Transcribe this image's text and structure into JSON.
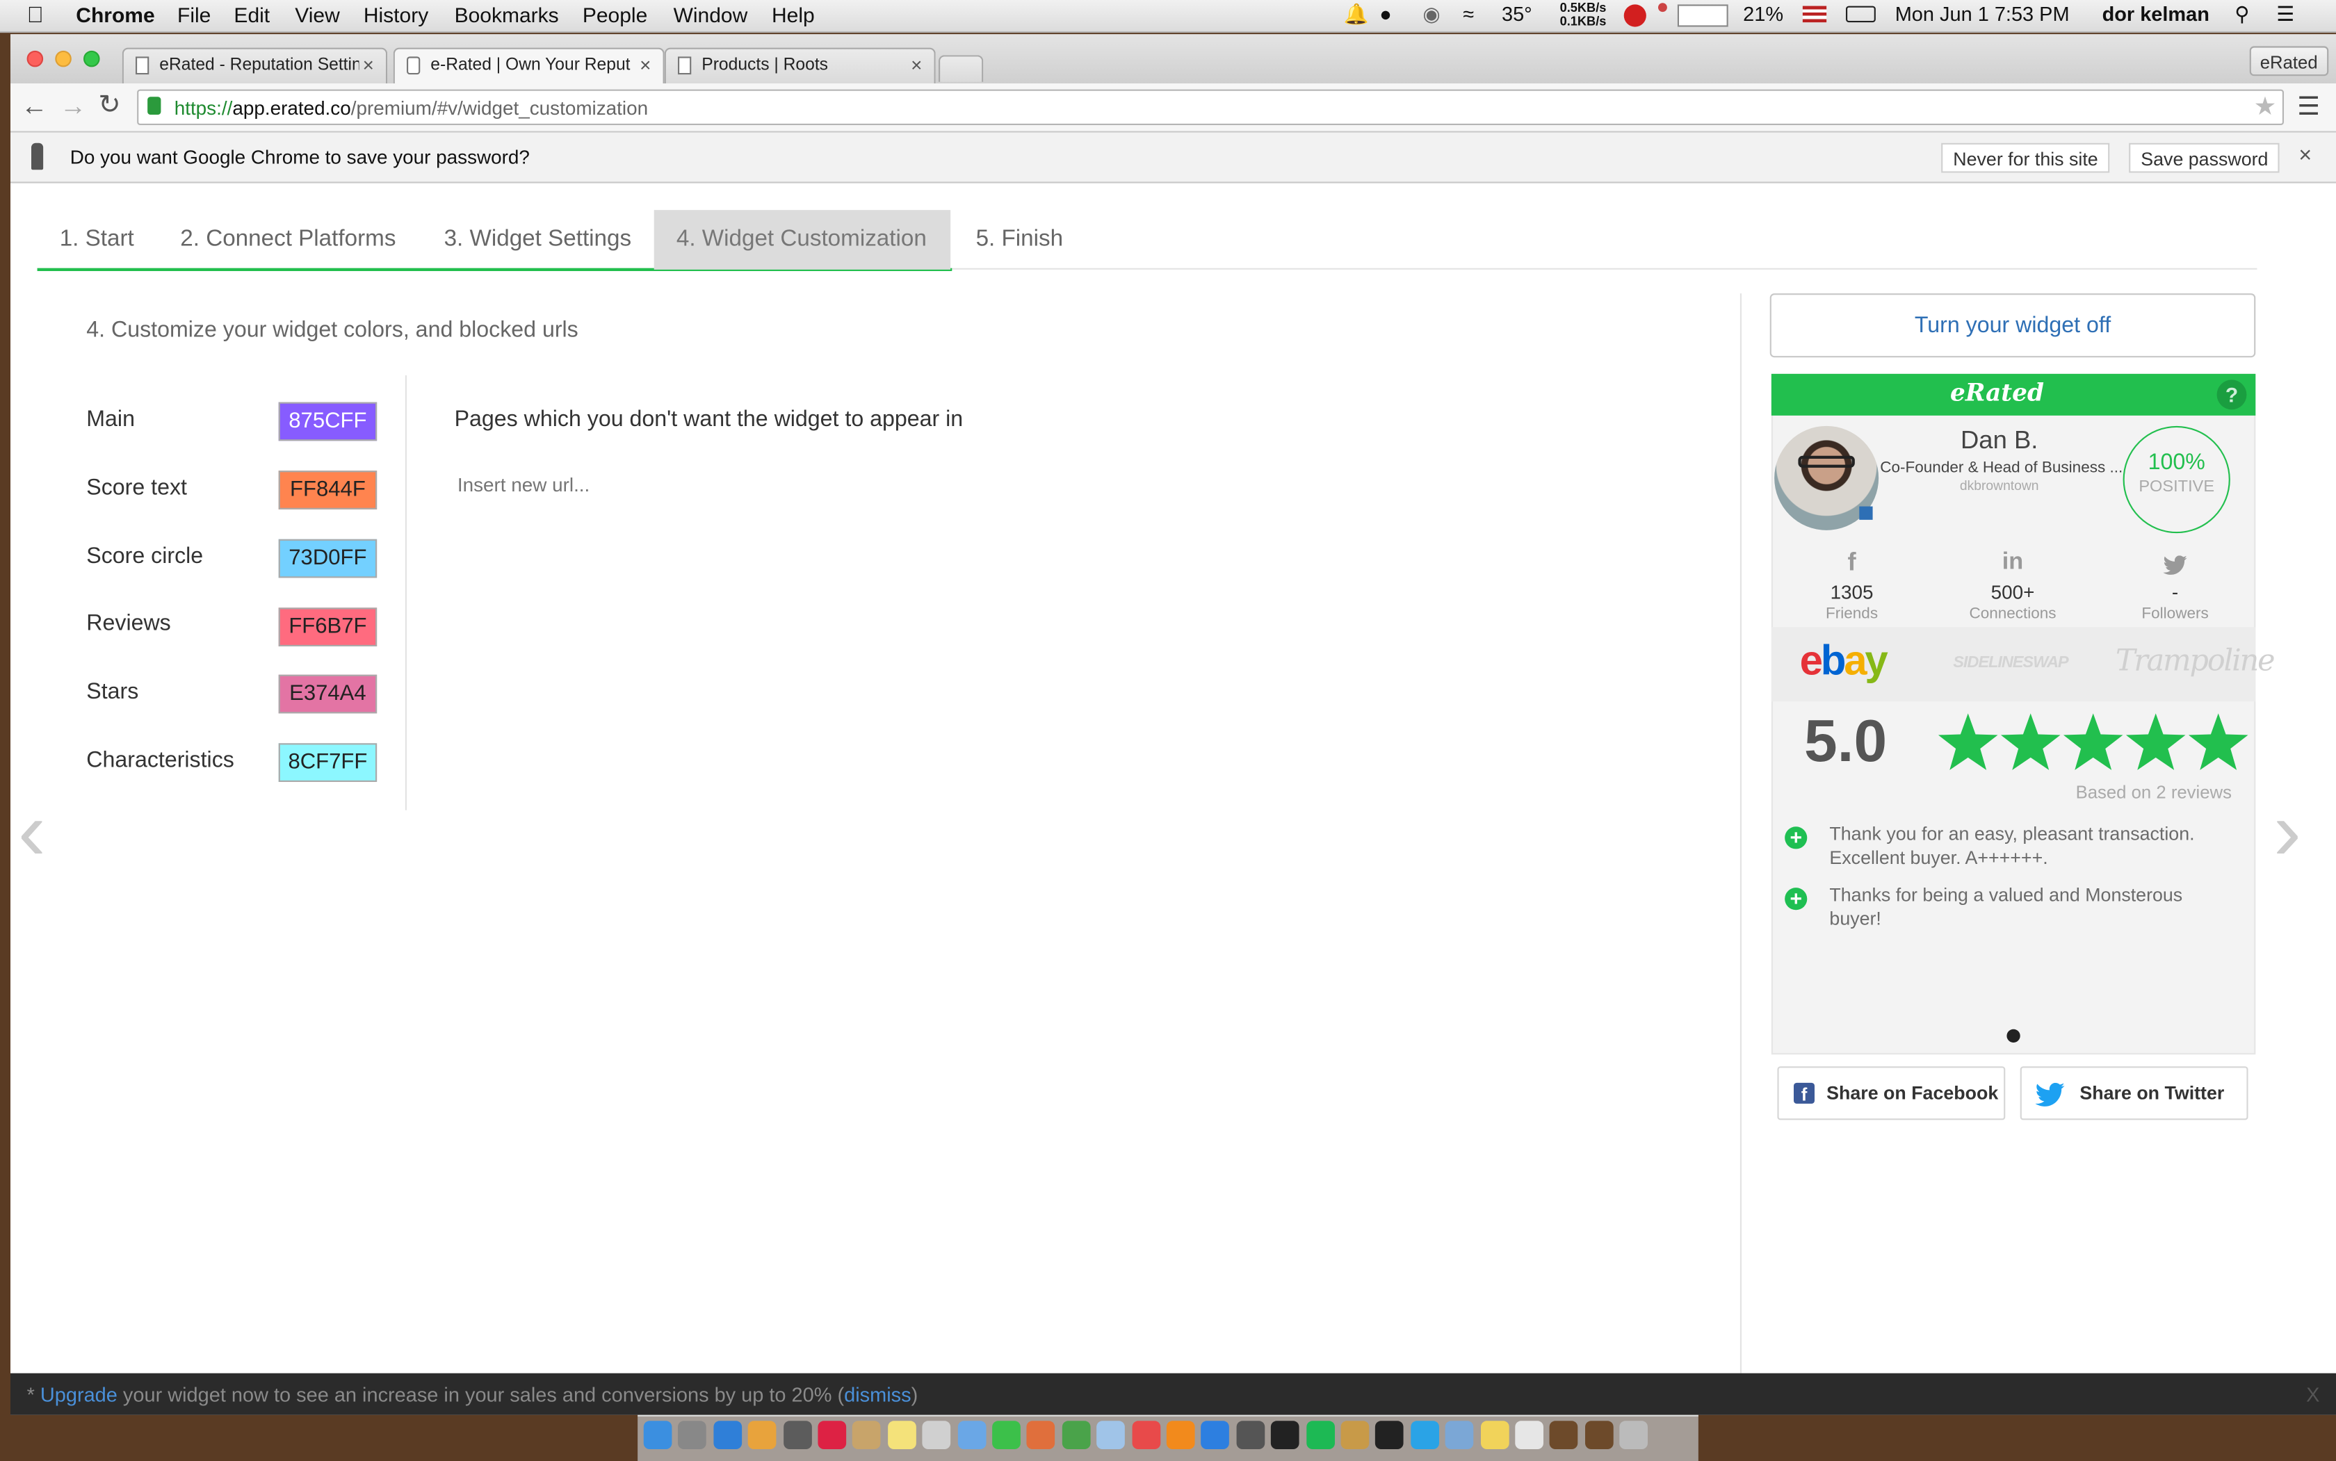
{
  "menubar": {
    "app": "Chrome",
    "items": [
      "File",
      "Edit",
      "View",
      "History",
      "Bookmarks",
      "People",
      "Window",
      "Help"
    ],
    "temperature": "35°",
    "net_up": "0.5KB/s",
    "net_down": "0.1KB/s",
    "battery": "21%",
    "datetime": "Mon Jun 1  7:53 PM",
    "user": "dor kelman"
  },
  "browser": {
    "tabs": [
      {
        "title": "eRated - Reputation Settin"
      },
      {
        "title": "e-Rated | Own Your Reputa"
      },
      {
        "title": "Products | Roots"
      }
    ],
    "profile": "eRated",
    "url_scheme": "https://",
    "url_host": "app.erated.co",
    "url_path": "/premium/#v/widget_customization",
    "infobar": {
      "message": "Do you want Google Chrome to save your password?",
      "never_label": "Never for this site",
      "save_label": "Save password"
    }
  },
  "wizard": {
    "tabs": [
      "1. Start",
      "2. Connect Platforms",
      "3. Widget Settings",
      "4. Widget Customization",
      "5. Finish"
    ],
    "active_tab": 3,
    "heading": "4. Customize your widget colors, and blocked urls",
    "colors": [
      {
        "label": "Main",
        "value": "875CFF",
        "color": "#875CFF"
      },
      {
        "label": "Score text",
        "value": "FF844F",
        "color": "#FF844F"
      },
      {
        "label": "Score circle",
        "value": "73D0FF",
        "color": "#73D0FF"
      },
      {
        "label": "Reviews",
        "value": "FF6B7F",
        "color": "#FF6B7F"
      },
      {
        "label": "Stars",
        "value": "E374A4",
        "color": "#E374A4"
      },
      {
        "label": "Characteristics",
        "value": "8CF7FF",
        "color": "#8CF7FF"
      }
    ],
    "blocked_urls_title": "Pages which you don't want the widget to appear in",
    "url_placeholder": "Insert new url..."
  },
  "widget": {
    "turn_off_label": "Turn your widget off",
    "brand": "eRated",
    "help": "?",
    "profile": {
      "name": "Dan B.",
      "title": "Co-Founder & Head of Business ...",
      "username": "dkbrowntown",
      "score": "100%",
      "score_label": "POSITIVE"
    },
    "social": [
      {
        "icon": "f",
        "count": "1305",
        "label": "Friends"
      },
      {
        "icon": "in",
        "count": "500+",
        "label": "Connections"
      },
      {
        "icon": "twitter-bird",
        "count": "-",
        "label": "Followers"
      }
    ],
    "platforms": [
      "ebay",
      "SIDELINESWAP",
      "Trampoline"
    ],
    "rating": "5.0",
    "stars": 5,
    "based_on": "Based on 2 reviews",
    "reviews": [
      "Thank you for an easy, pleasant transaction. Excellent buyer. A++++++.",
      "Thanks for being a valued and Monsterous buyer!"
    ],
    "share_facebook": "Share on Facebook",
    "share_twitter": "Share on Twitter"
  },
  "bottom_banner": {
    "prefix": "* ",
    "upgrade_link": "Upgrade",
    "message": " your widget now to see an increase in your sales and conversions by up to 20% (",
    "dismiss_link": "dismiss",
    "suffix": ")",
    "close": "X"
  },
  "colors": {
    "green": "#22BF4E",
    "link_blue": "#2E6FB5"
  }
}
